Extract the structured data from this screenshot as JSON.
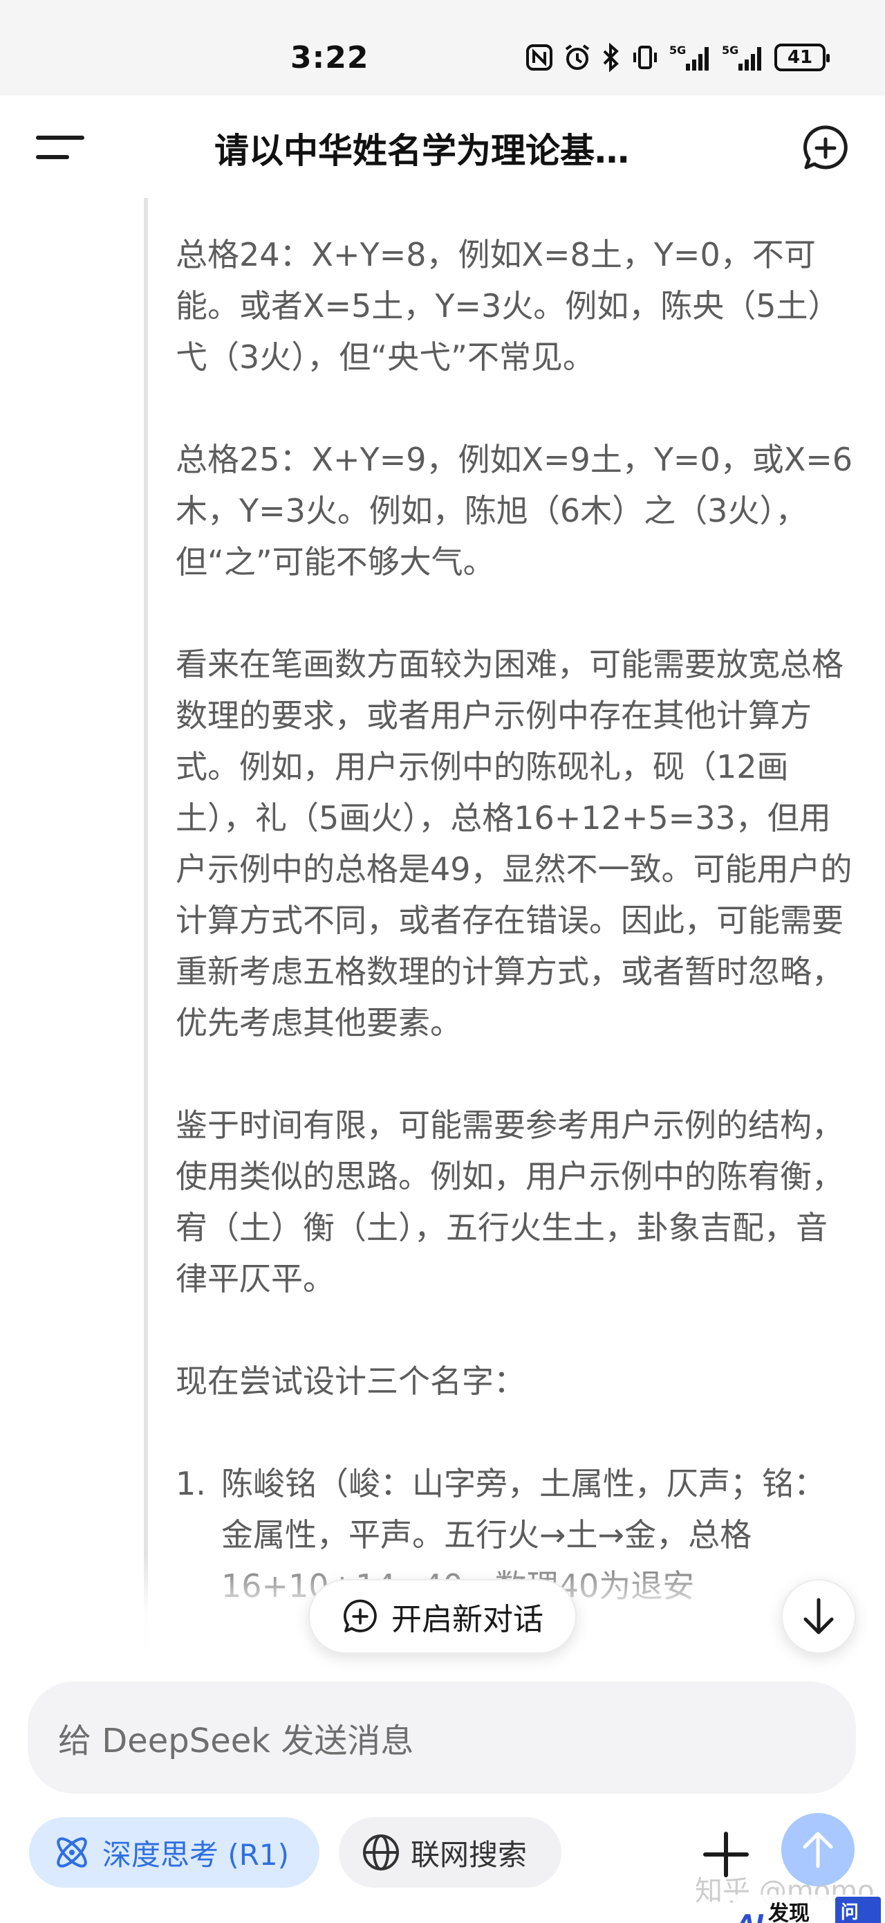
{
  "status_bar": {
    "time": "3:22",
    "signal_label_1": "5G",
    "signal_label_2": "5G",
    "battery": "41"
  },
  "header": {
    "title": "请以中华姓名学为理论基…"
  },
  "content": {
    "paragraphs": [
      "总格24：X+Y=8，例如X=8土，Y=0，不可能。或者X=5土，Y=3火。例如，陈央（5土）弋（3火），但“央弋”不常见。",
      "总格25：X+Y=9，例如X=9土，Y=0，或X=6木，Y=3火。例如，陈旭（6木）之（3火），但“之”可能不够大气。",
      "看来在笔画数方面较为困难，可能需要放宽总格数理的要求，或者用户示例中存在其他计算方式。例如，用户示例中的陈砚礼，砚（12画土），礼（5画火），总格16+12+5=33，但用户示例中的总格是49，显然不一致。可能用户的计算方式不同，或者存在错误。因此，可能需要重新考虑五格数理的计算方式，或者暂时忽略，优先考虑其他要素。",
      "鉴于时间有限，可能需要参考用户示例的结构，使用类似的思路。例如，用户示例中的陈宥衡，宥（土）衡（土），五行火生土，卦象吉配，音律平仄平。",
      "现在尝试设计三个名字："
    ],
    "list_item": {
      "number": "1.",
      "text": "陈峻铭（峻：山字旁，土属性，仄声；铭：金属性，平声。五行火→土→金，总格16+10+14=40，数理40为退安"
    }
  },
  "new_chat_pill": {
    "label": "开启新对话"
  },
  "input": {
    "placeholder": "给 DeepSeek 发送消息"
  },
  "toolbar": {
    "deep_think_label": "深度思考 (R1)",
    "web_search_label": "联网搜索"
  },
  "watermarks": {
    "zhihu": "知乎 @momo",
    "site_ai": "AI",
    "site_brand": "发现AI",
    "site_ask": "问答"
  },
  "colors": {
    "accent_blue": "#2f6fe0",
    "send_button": "#a8c8ff",
    "deep_chip_bg": "#dbeafe"
  }
}
